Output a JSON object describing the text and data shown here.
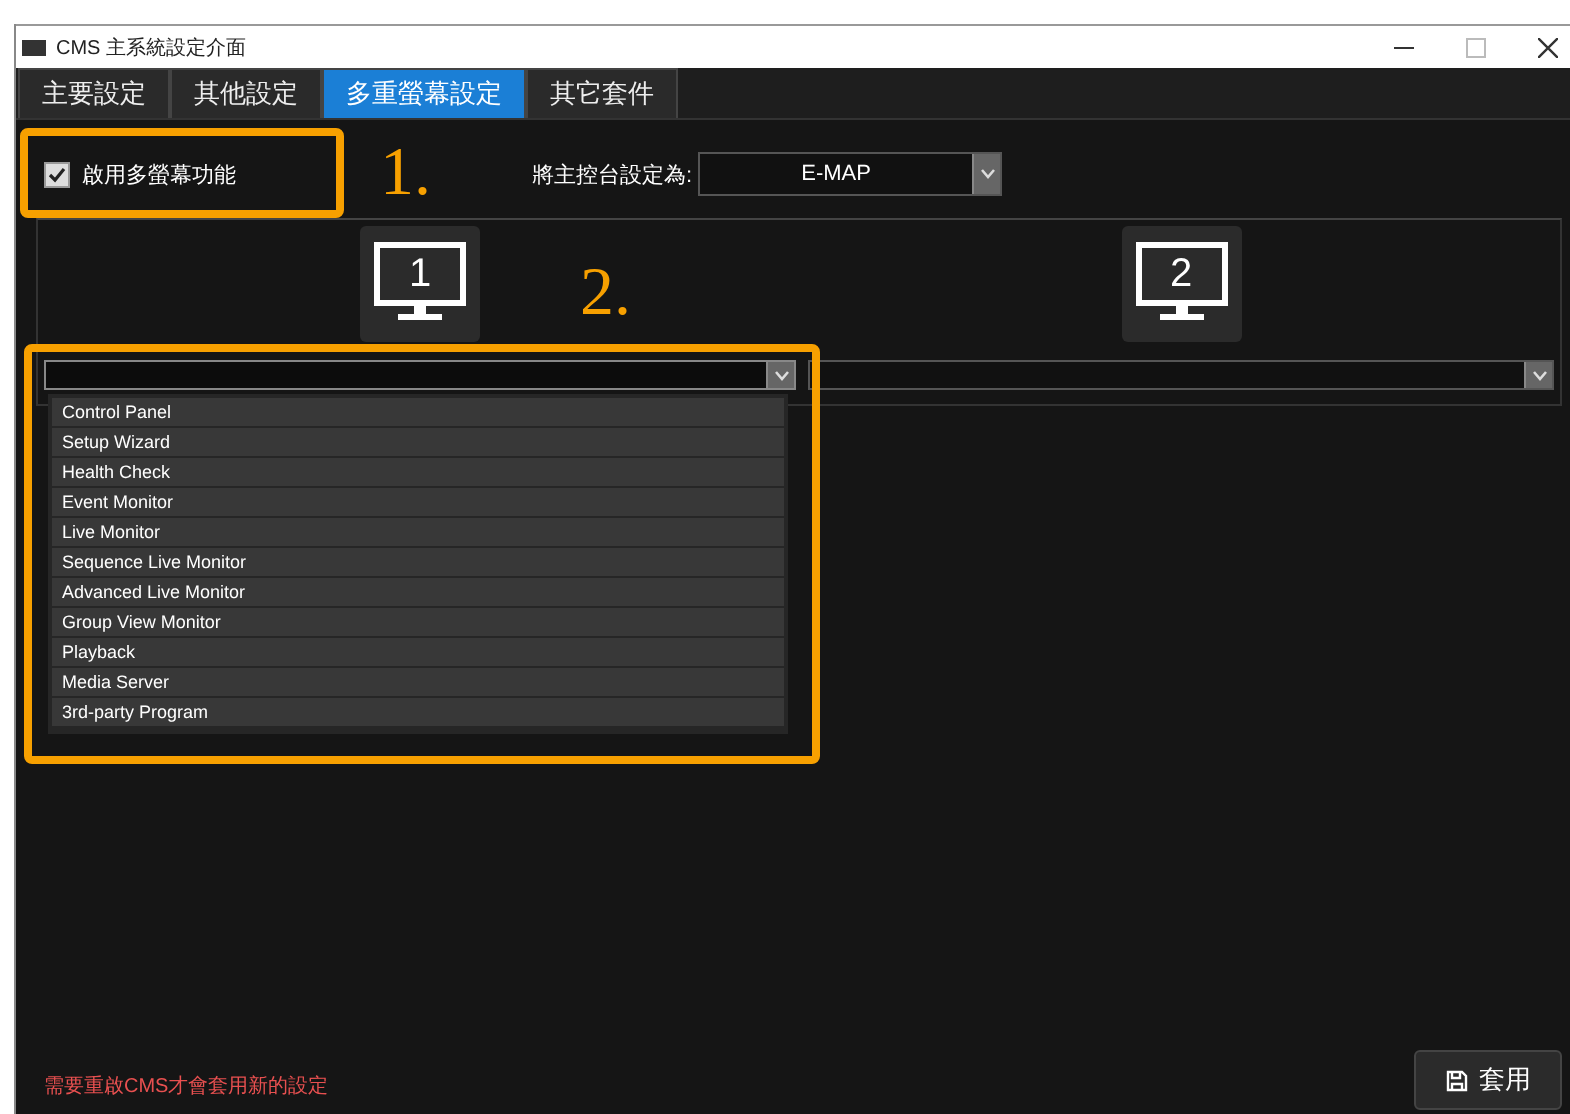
{
  "window": {
    "title": "CMS 主系統設定介面"
  },
  "tabs": [
    {
      "label": "主要設定",
      "selected": false
    },
    {
      "label": "其他設定",
      "selected": false
    },
    {
      "label": "多重螢幕設定",
      "selected": true
    },
    {
      "label": "其它套件",
      "selected": false
    }
  ],
  "enable_multi_screen": {
    "label": "啟用多螢幕功能",
    "checked": true
  },
  "main_console": {
    "label": "將主控台設定為:",
    "value": "E-MAP"
  },
  "monitors": [
    {
      "number": "1",
      "expanded": true,
      "options": [
        "Control Panel",
        "Setup Wizard",
        "Health Check",
        "Event Monitor",
        "Live Monitor",
        "Sequence Live Monitor",
        "Advanced Live Monitor",
        "Group View Monitor",
        "Playback",
        "Media Server",
        "3rd-party Program"
      ]
    },
    {
      "number": "2",
      "expanded": false
    }
  ],
  "annotations": [
    {
      "label": "1."
    },
    {
      "label": "2."
    }
  ],
  "notice": "需要重啟CMS才會套用新的設定",
  "apply_button": {
    "label": "套用"
  }
}
